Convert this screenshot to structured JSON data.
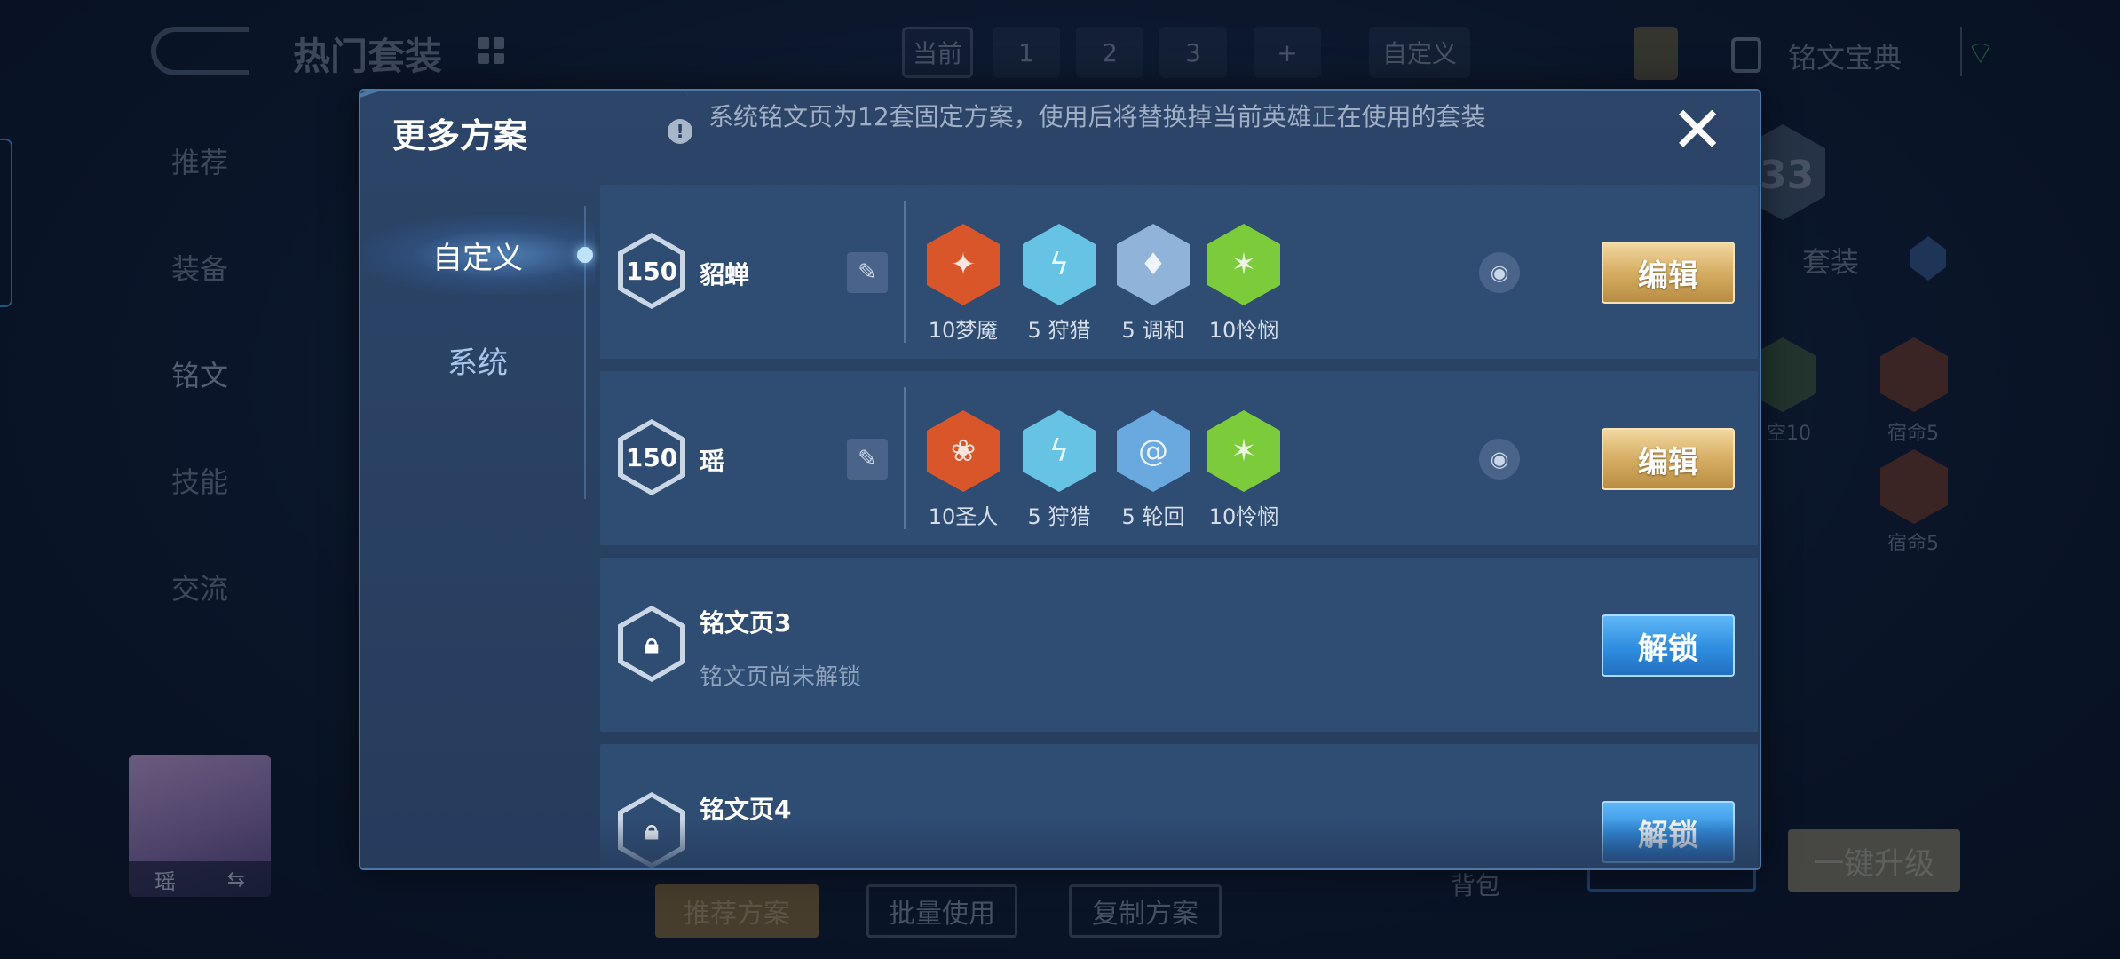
{
  "background": {
    "title": "热门套装",
    "page_tabs": [
      "当前",
      "1",
      "2",
      "3",
      "+",
      "自定义"
    ],
    "top_right_label": "铭文宝典",
    "nav": [
      "推荐",
      "装备",
      "铭文",
      "技能",
      "交流"
    ],
    "right_partial_number": "33",
    "right_partial_label": "套装",
    "rune_labels": [
      "空10",
      "宿命5",
      "宿命5"
    ],
    "avatar_name": "瑶",
    "bottom_buttons": [
      "推荐方案",
      "批量使用",
      "复制方案"
    ],
    "bag_label": "背包",
    "upgrade_label": "一键升级"
  },
  "modal": {
    "title": "更多方案",
    "info_text": "系统铭文页为12套固定方案，使用后将替换掉当前英雄正在使用的套装",
    "close_symbol": "✕",
    "sidebar": [
      "自定义",
      "系统"
    ],
    "pages": [
      {
        "level": "150",
        "name": "貂蝉",
        "runes": [
          {
            "label": "10梦魇",
            "color": "#d9562b"
          },
          {
            "label": "5 狩猎",
            "color": "#67c3e3"
          },
          {
            "label": "5 调和",
            "color": "#8fb3d9"
          },
          {
            "label": "10怜悯",
            "color": "#7ccb3b"
          }
        ],
        "action": "编辑"
      },
      {
        "level": "150",
        "name": "瑶",
        "runes": [
          {
            "label": "10圣人",
            "color": "#d9562b"
          },
          {
            "label": "5 狩猎",
            "color": "#67c3e3"
          },
          {
            "label": "5 轮回",
            "color": "#6aa8e0"
          },
          {
            "label": "10怜悯",
            "color": "#7ccb3b"
          }
        ],
        "action": "编辑"
      },
      {
        "name": "铭文页3",
        "status": "铭文页尚未解锁",
        "action": "解锁"
      },
      {
        "name": "铭文页4",
        "action": "解锁"
      }
    ]
  }
}
